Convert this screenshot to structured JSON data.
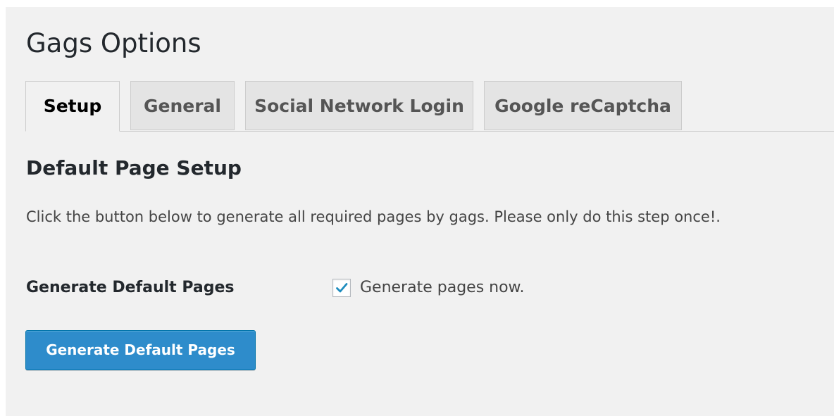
{
  "page": {
    "title": "Gags Options"
  },
  "tabs": [
    {
      "label": "Setup",
      "active": true
    },
    {
      "label": "General",
      "active": false
    },
    {
      "label": "Social Network Login",
      "active": false
    },
    {
      "label": "Google reCaptcha",
      "active": false
    }
  ],
  "section": {
    "title": "Default Page Setup",
    "description": "Click the button below to generate all required pages by gags. Please only do this step once!."
  },
  "field": {
    "label": "Generate Default Pages",
    "checkbox_label": "Generate pages now.",
    "checked": true
  },
  "action": {
    "button_label": "Generate Default Pages"
  },
  "colors": {
    "background": "#f1f1f1",
    "tab_inactive": "#e4e4e4",
    "primary_button": "#2e8ccb",
    "checkmark": "#1e8cbe"
  }
}
